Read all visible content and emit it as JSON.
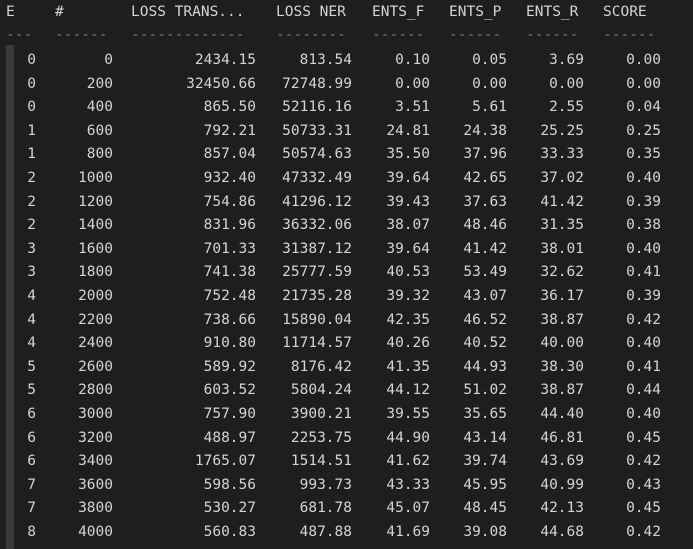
{
  "table": {
    "headers": [
      "E",
      "#",
      "LOSS TRANS...",
      "LOSS NER",
      "ENTS_F",
      "ENTS_P",
      "ENTS_R",
      "SCORE"
    ],
    "separators": [
      "---",
      "------",
      "-------------",
      "--------",
      "------",
      "------",
      "------",
      "------"
    ],
    "rows": [
      [
        "0",
        "0",
        "2434.15",
        "813.54",
        "0.10",
        "0.05",
        "3.69",
        "0.00"
      ],
      [
        "0",
        "200",
        "32450.66",
        "72748.99",
        "0.00",
        "0.00",
        "0.00",
        "0.00"
      ],
      [
        "0",
        "400",
        "865.50",
        "52116.16",
        "3.51",
        "5.61",
        "2.55",
        "0.04"
      ],
      [
        "1",
        "600",
        "792.21",
        "50733.31",
        "24.81",
        "24.38",
        "25.25",
        "0.25"
      ],
      [
        "1",
        "800",
        "857.04",
        "50574.63",
        "35.50",
        "37.96",
        "33.33",
        "0.35"
      ],
      [
        "2",
        "1000",
        "932.40",
        "47332.49",
        "39.64",
        "42.65",
        "37.02",
        "0.40"
      ],
      [
        "2",
        "1200",
        "754.86",
        "41296.12",
        "39.43",
        "37.63",
        "41.42",
        "0.39"
      ],
      [
        "2",
        "1400",
        "831.96",
        "36332.06",
        "38.07",
        "48.46",
        "31.35",
        "0.38"
      ],
      [
        "3",
        "1600",
        "701.33",
        "31387.12",
        "39.64",
        "41.42",
        "38.01",
        "0.40"
      ],
      [
        "3",
        "1800",
        "741.38",
        "25777.59",
        "40.53",
        "53.49",
        "32.62",
        "0.41"
      ],
      [
        "4",
        "2000",
        "752.48",
        "21735.28",
        "39.32",
        "43.07",
        "36.17",
        "0.39"
      ],
      [
        "4",
        "2200",
        "738.66",
        "15890.04",
        "42.35",
        "46.52",
        "38.87",
        "0.42"
      ],
      [
        "4",
        "2400",
        "910.80",
        "11714.57",
        "40.26",
        "40.52",
        "40.00",
        "0.40"
      ],
      [
        "5",
        "2600",
        "589.92",
        "8176.42",
        "41.35",
        "44.93",
        "38.30",
        "0.41"
      ],
      [
        "5",
        "2800",
        "603.52",
        "5804.24",
        "44.12",
        "51.02",
        "38.87",
        "0.44"
      ],
      [
        "6",
        "3000",
        "757.90",
        "3900.21",
        "39.55",
        "35.65",
        "44.40",
        "0.40"
      ],
      [
        "6",
        "3200",
        "488.97",
        "2253.75",
        "44.90",
        "43.14",
        "46.81",
        "0.45"
      ],
      [
        "6",
        "3400",
        "1765.07",
        "1514.51",
        "41.62",
        "39.74",
        "43.69",
        "0.42"
      ],
      [
        "7",
        "3600",
        "598.56",
        "993.73",
        "43.33",
        "45.95",
        "40.99",
        "0.43"
      ],
      [
        "7",
        "3800",
        "530.27",
        "681.78",
        "45.07",
        "48.45",
        "42.13",
        "0.45"
      ],
      [
        "8",
        "4000",
        "560.83",
        "487.88",
        "41.69",
        "39.08",
        "44.68",
        "0.42"
      ]
    ]
  }
}
